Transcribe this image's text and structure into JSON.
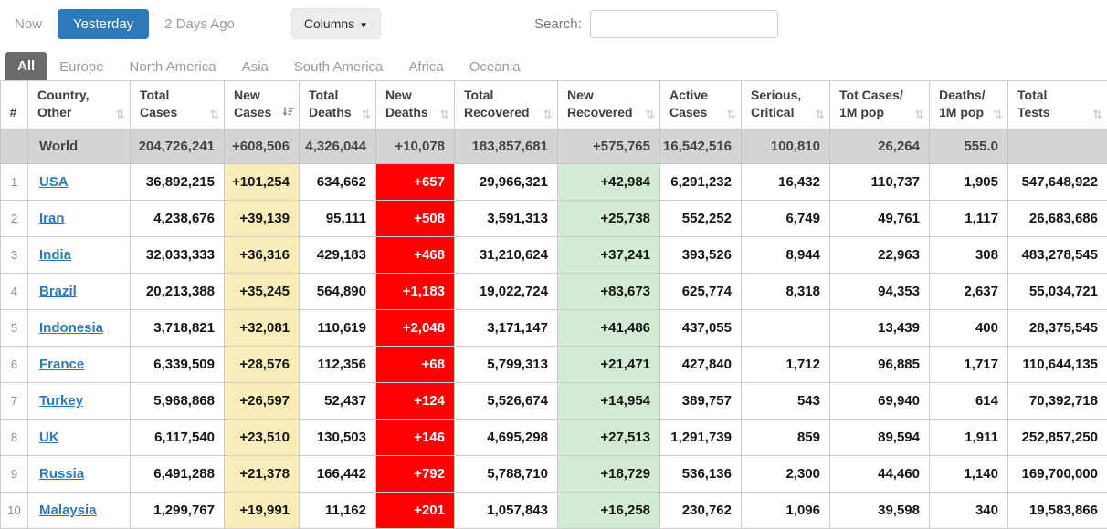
{
  "toolbar": {
    "now_label": "Now",
    "yesterday_label": "Yesterday",
    "two_days_ago_label": "2 Days Ago",
    "columns_label": "Columns",
    "search_label": "Search:",
    "search_value": ""
  },
  "continent_tabs": [
    {
      "label": "All",
      "active": true
    },
    {
      "label": "Europe",
      "active": false
    },
    {
      "label": "North America",
      "active": false
    },
    {
      "label": "Asia",
      "active": false
    },
    {
      "label": "South America",
      "active": false
    },
    {
      "label": "Africa",
      "active": false
    },
    {
      "label": "Oceania",
      "active": false
    }
  ],
  "colors": {
    "accent_blue": "#2e7ab8",
    "link_blue": "#3079b8",
    "active_tab_gray": "#6b6b6b",
    "world_row_gray": "#d4d4d4",
    "highlight_yellow": "#f8ecb8",
    "highlight_red": "#ff0000",
    "highlight_green": "#d3ead3"
  },
  "table": {
    "columns": [
      {
        "id": "rank",
        "lines": [
          "#"
        ],
        "sortable": false
      },
      {
        "id": "country",
        "lines": [
          "Country,",
          "Other"
        ],
        "sortable": true
      },
      {
        "id": "total_cases",
        "lines": [
          "Total",
          "Cases"
        ],
        "sortable": true
      },
      {
        "id": "new_cases",
        "lines": [
          "New",
          "Cases"
        ],
        "sortable": true,
        "sorted": "desc"
      },
      {
        "id": "total_deaths",
        "lines": [
          "Total",
          "Deaths"
        ],
        "sortable": true
      },
      {
        "id": "new_deaths",
        "lines": [
          "New",
          "Deaths"
        ],
        "sortable": true
      },
      {
        "id": "total_recovered",
        "lines": [
          "Total",
          "Recovered"
        ],
        "sortable": true
      },
      {
        "id": "new_recovered",
        "lines": [
          "New",
          "Recovered"
        ],
        "sortable": true
      },
      {
        "id": "active_cases",
        "lines": [
          "Active",
          "Cases"
        ],
        "sortable": true
      },
      {
        "id": "serious_critical",
        "lines": [
          "Serious,",
          "Critical"
        ],
        "sortable": true
      },
      {
        "id": "tot_cases_1m",
        "lines": [
          "Tot Cases/",
          "1M pop"
        ],
        "sortable": true
      },
      {
        "id": "deaths_1m",
        "lines": [
          "Deaths/",
          "1M pop"
        ],
        "sortable": true
      },
      {
        "id": "total_tests",
        "lines": [
          "Total",
          "Tests"
        ],
        "sortable": true
      }
    ],
    "world_row": {
      "rank": "",
      "country": "World",
      "total_cases": "204,726,241",
      "new_cases": "+608,506",
      "total_deaths": "4,326,044",
      "new_deaths": "+10,078",
      "total_recovered": "183,857,681",
      "new_recovered": "+575,765",
      "active_cases": "16,542,516",
      "serious_critical": "100,810",
      "tot_cases_1m": "26,264",
      "deaths_1m": "555.0",
      "total_tests": ""
    },
    "rows": [
      {
        "rank": "1",
        "country": "USA",
        "total_cases": "36,892,215",
        "new_cases": "+101,254",
        "total_deaths": "634,662",
        "new_deaths": "+657",
        "total_recovered": "29,966,321",
        "new_recovered": "+42,984",
        "active_cases": "6,291,232",
        "serious_critical": "16,432",
        "tot_cases_1m": "110,737",
        "deaths_1m": "1,905",
        "total_tests": "547,648,922"
      },
      {
        "rank": "2",
        "country": "Iran",
        "total_cases": "4,238,676",
        "new_cases": "+39,139",
        "total_deaths": "95,111",
        "new_deaths": "+508",
        "total_recovered": "3,591,313",
        "new_recovered": "+25,738",
        "active_cases": "552,252",
        "serious_critical": "6,749",
        "tot_cases_1m": "49,761",
        "deaths_1m": "1,117",
        "total_tests": "26,683,686"
      },
      {
        "rank": "3",
        "country": "India",
        "total_cases": "32,033,333",
        "new_cases": "+36,316",
        "total_deaths": "429,183",
        "new_deaths": "+468",
        "total_recovered": "31,210,624",
        "new_recovered": "+37,241",
        "active_cases": "393,526",
        "serious_critical": "8,944",
        "tot_cases_1m": "22,963",
        "deaths_1m": "308",
        "total_tests": "483,278,545"
      },
      {
        "rank": "4",
        "country": "Brazil",
        "total_cases": "20,213,388",
        "new_cases": "+35,245",
        "total_deaths": "564,890",
        "new_deaths": "+1,183",
        "total_recovered": "19,022,724",
        "new_recovered": "+83,673",
        "active_cases": "625,774",
        "serious_critical": "8,318",
        "tot_cases_1m": "94,353",
        "deaths_1m": "2,637",
        "total_tests": "55,034,721"
      },
      {
        "rank": "5",
        "country": "Indonesia",
        "total_cases": "3,718,821",
        "new_cases": "+32,081",
        "total_deaths": "110,619",
        "new_deaths": "+2,048",
        "total_recovered": "3,171,147",
        "new_recovered": "+41,486",
        "active_cases": "437,055",
        "serious_critical": "",
        "tot_cases_1m": "13,439",
        "deaths_1m": "400",
        "total_tests": "28,375,545"
      },
      {
        "rank": "6",
        "country": "France",
        "total_cases": "6,339,509",
        "new_cases": "+28,576",
        "total_deaths": "112,356",
        "new_deaths": "+68",
        "total_recovered": "5,799,313",
        "new_recovered": "+21,471",
        "active_cases": "427,840",
        "serious_critical": "1,712",
        "tot_cases_1m": "96,885",
        "deaths_1m": "1,717",
        "total_tests": "110,644,135"
      },
      {
        "rank": "7",
        "country": "Turkey",
        "total_cases": "5,968,868",
        "new_cases": "+26,597",
        "total_deaths": "52,437",
        "new_deaths": "+124",
        "total_recovered": "5,526,674",
        "new_recovered": "+14,954",
        "active_cases": "389,757",
        "serious_critical": "543",
        "tot_cases_1m": "69,940",
        "deaths_1m": "614",
        "total_tests": "70,392,718"
      },
      {
        "rank": "8",
        "country": "UK",
        "total_cases": "6,117,540",
        "new_cases": "+23,510",
        "total_deaths": "130,503",
        "new_deaths": "+146",
        "total_recovered": "4,695,298",
        "new_recovered": "+27,513",
        "active_cases": "1,291,739",
        "serious_critical": "859",
        "tot_cases_1m": "89,594",
        "deaths_1m": "1,911",
        "total_tests": "252,857,250"
      },
      {
        "rank": "9",
        "country": "Russia",
        "total_cases": "6,491,288",
        "new_cases": "+21,378",
        "total_deaths": "166,442",
        "new_deaths": "+792",
        "total_recovered": "5,788,710",
        "new_recovered": "+18,729",
        "active_cases": "536,136",
        "serious_critical": "2,300",
        "tot_cases_1m": "44,460",
        "deaths_1m": "1,140",
        "total_tests": "169,700,000"
      },
      {
        "rank": "10",
        "country": "Malaysia",
        "total_cases": "1,299,767",
        "new_cases": "+19,991",
        "total_deaths": "11,162",
        "new_deaths": "+201",
        "total_recovered": "1,057,843",
        "new_recovered": "+16,258",
        "active_cases": "230,762",
        "serious_critical": "1,096",
        "tot_cases_1m": "39,598",
        "deaths_1m": "340",
        "total_tests": "19,583,866"
      }
    ]
  }
}
